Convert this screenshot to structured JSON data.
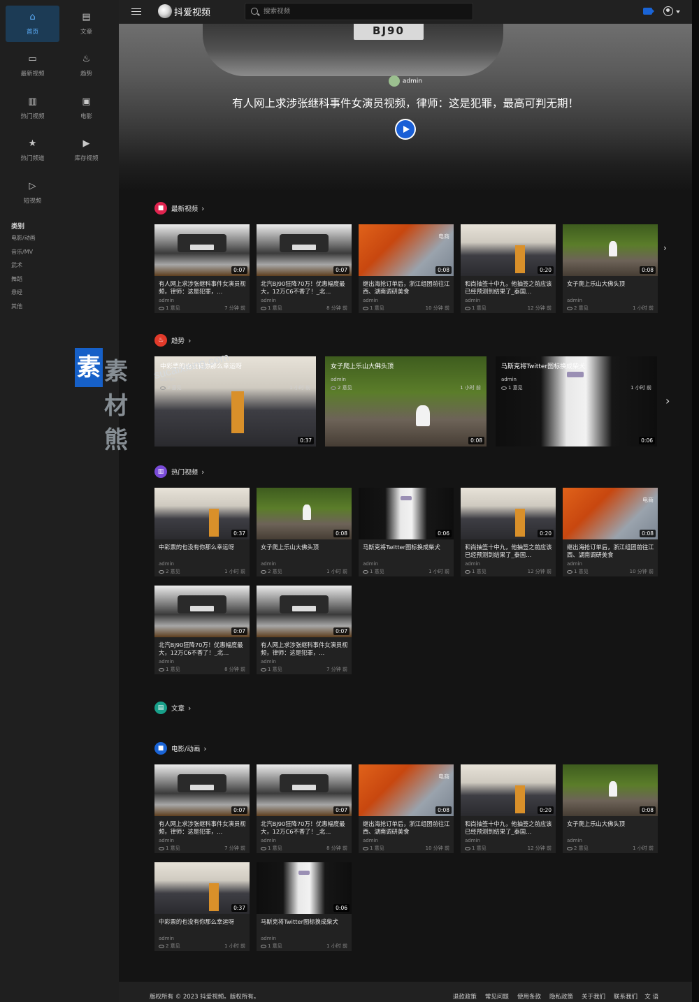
{
  "sidebar": {
    "nav": [
      {
        "label": "首页",
        "icon": "home-icon"
      },
      {
        "label": "文章",
        "icon": "article-icon"
      },
      {
        "label": "最新视频",
        "icon": "video-icon"
      },
      {
        "label": "趋势",
        "icon": "fire-icon"
      },
      {
        "label": "热门视频",
        "icon": "chart-icon"
      },
      {
        "label": "电影",
        "icon": "film-icon"
      },
      {
        "label": "热门频道",
        "icon": "star-icon"
      },
      {
        "label": "库存视频",
        "icon": "library-icon"
      },
      {
        "label": "短视频",
        "icon": "shorts-icon"
      }
    ],
    "categories_title": "类别",
    "categories": [
      "电影/动画",
      "音乐/MV",
      "武术",
      "舞蹈",
      "悬经",
      "其他"
    ]
  },
  "topbar": {
    "logo_text": "抖爱视频",
    "search_placeholder": "搜索视频"
  },
  "hero": {
    "author": "admin",
    "title": "有人网上求涉张继科事件女演员视频，律师：这是犯罪，最高可判无期！",
    "plate": "BJ90"
  },
  "sections": {
    "latest": {
      "title": "最新视频"
    },
    "trending": {
      "title": "趋势"
    },
    "hot": {
      "title": "热门视频"
    },
    "articles": {
      "title": "文章"
    },
    "movies": {
      "title": "电影/动画"
    }
  },
  "latest_cards": [
    {
      "title": "有人网上求涉张继科事件女演员视频，律师：这是犯罪，…",
      "author": "admin",
      "views": "1 意见",
      "time": "7 分钟 前",
      "duration": "0:07"
    },
    {
      "title": "北汽BJ90狂降70万！优惠幅度最大，12万C6不香了！_北…",
      "author": "admin",
      "views": "1 意见",
      "time": "8 分钟 前",
      "duration": "0:07"
    },
    {
      "title": "继出海抢订单后，浙江组团前往江西、湖南调研美食",
      "author": "admin",
      "views": "1 意见",
      "time": "10 分钟 前",
      "duration": "0:08"
    },
    {
      "title": "和尚抽签十中九，他抽签之前应该已经预测到结果了_泰国…",
      "author": "admin",
      "views": "1 意见",
      "time": "12 分钟 前",
      "duration": "0:20"
    },
    {
      "title": "女子爬上乐山大佛头顶",
      "author": "admin",
      "views": "2 意见",
      "time": "1 小时 前",
      "duration": "0:08"
    }
  ],
  "trending_cards": [
    {
      "title": "中彩票的也没有你那么幸运呀",
      "author": "admin",
      "views": "2 意见",
      "time": "1 小时 前",
      "duration": "0:37"
    },
    {
      "title": "女子爬上乐山大佛头顶",
      "author": "admin",
      "views": "2 意见",
      "time": "1 小时 前",
      "duration": "0:08"
    },
    {
      "title": "马斯克将Twitter图标换成柴犬",
      "author": "admin",
      "views": "1 意见",
      "time": "1 小时 前",
      "duration": "0:06"
    }
  ],
  "hot_cards": [
    {
      "title": "中彩票的也没有你那么幸运呀",
      "author": "admin",
      "views": "2 意见",
      "time": "1 小时 前",
      "duration": "0:37"
    },
    {
      "title": "女子爬上乐山大佛头顶",
      "author": "admin",
      "views": "2 意见",
      "time": "1 小时 前",
      "duration": "0:08"
    },
    {
      "title": "马斯克将Twitter图标换成柴犬",
      "author": "admin",
      "views": "1 意见",
      "time": "1 小时 前",
      "duration": "0:06"
    },
    {
      "title": "和尚抽签十中九，他抽签之前应该已经预测到结果了_泰国…",
      "author": "admin",
      "views": "1 意见",
      "time": "12 分钟 前",
      "duration": "0:20"
    },
    {
      "title": "继出海抢订单后，浙江组团前往江西、湖南调研美食",
      "author": "admin",
      "views": "1 意见",
      "time": "10 分钟 前",
      "duration": "0:08"
    },
    {
      "title": "北汽BJ90狂降70万！优惠幅度最大，12万C6不香了！_北…",
      "author": "admin",
      "views": "1 意见",
      "time": "8 分钟 前",
      "duration": "0:07"
    },
    {
      "title": "有人网上求涉张继科事件女演员视频，律师：这是犯罪，…",
      "author": "admin",
      "views": "1 意见",
      "time": "7 分钟 前",
      "duration": "0:07"
    }
  ],
  "movie_cards": [
    {
      "title": "有人网上求涉张继科事件女演员视频，律师：这是犯罪，…",
      "author": "admin",
      "views": "1 意见",
      "time": "7 分钟 前",
      "duration": "0:07"
    },
    {
      "title": "北汽BJ90狂降70万！优惠幅度最大，12万C6不香了！_北…",
      "author": "admin",
      "views": "1 意见",
      "time": "8 分钟 前",
      "duration": "0:07"
    },
    {
      "title": "继出海抢订单后，浙江组团前往江西、湖南调研美食",
      "author": "admin",
      "views": "1 意见",
      "time": "10 分钟 前",
      "duration": "0:08"
    },
    {
      "title": "和尚抽签十中九，他抽签之前应该已经预测到结果了_泰国…",
      "author": "admin",
      "views": "1 意见",
      "time": "12 分钟 前",
      "duration": "0:20"
    },
    {
      "title": "女子爬上乐山大佛头顶",
      "author": "admin",
      "views": "2 意见",
      "time": "1 小时 前",
      "duration": "0:08"
    },
    {
      "title": "中彩票的也没有你那么幸运呀",
      "author": "admin",
      "views": "2 意见",
      "time": "1 小时 前",
      "duration": "0:37"
    },
    {
      "title": "马斯克将Twitter图标换成柴犬",
      "author": "admin",
      "views": "1 意见",
      "time": "1 小时 前",
      "duration": "0:06"
    }
  ],
  "footer": {
    "copyright": "版权所有 © 2023 抖爱视频。版权所有。",
    "links": [
      "退款政策",
      "常见问题",
      "使用条款",
      "隐私政策",
      "关于我们",
      "联系我们"
    ],
    "lang": "文 语"
  },
  "watermark": {
    "text": "素材熊",
    "url": "sucaixiong.com"
  },
  "colors": {
    "accent": "#1a64d6",
    "latest": "#e0244f",
    "trending": "#e23a2a",
    "hot": "#7a4bd8",
    "articles": "#18a08a",
    "movies": "#1a64d6",
    "sidebar_active": "#1c3b55"
  }
}
